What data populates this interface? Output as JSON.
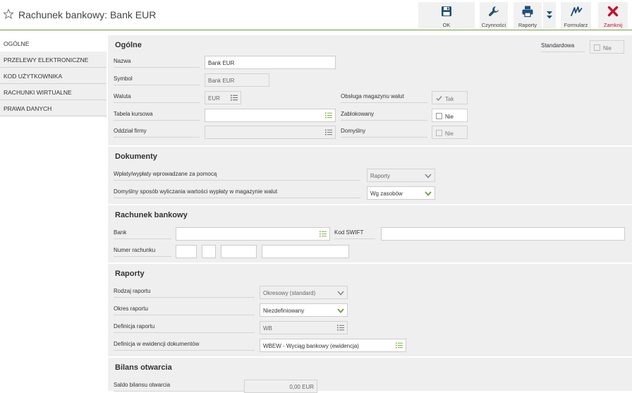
{
  "window": {
    "title": "Rachunek bankowy: Bank EUR"
  },
  "toolbar": {
    "ok": "OK",
    "actions": "Czynności",
    "reports": "Raporty",
    "form": "Formularz",
    "close": "Zamknij"
  },
  "tabs": [
    "OGÓLNE",
    "PRZELEWY ELEKTRONICZNE",
    "KOD UŻYTKOWNIKA",
    "RACHUNKI WIRTUALNE",
    "PRAWA DANYCH"
  ],
  "general": {
    "heading": "Ogólne",
    "standard_label": "Standardowa",
    "standard_value": "Nie",
    "name_label": "Nazwa",
    "name_value": "Bank EUR",
    "symbol_label": "Symbol",
    "symbol_value": "Bank EUR",
    "currency_label": "Waluta",
    "currency_value": "EUR",
    "rate_table_label": "Tabela kursowa",
    "rate_table_value": "",
    "branch_label": "Oddział firmy",
    "branch_value": "",
    "warehouse_label": "Obsługa magazynu walut",
    "warehouse_value": "Tak",
    "blocked_label": "Zablokowany",
    "blocked_value": "Nie",
    "default_label": "Domyślny",
    "default_value": "Nie"
  },
  "documents": {
    "heading": "Dokumenty",
    "entry_label": "Wpłaty/wypłaty wprowadzane za pomocą",
    "entry_value": "Raporty",
    "calc_label": "Domyślny sposób wyliczania wartości wypłaty w magazynie walut",
    "calc_value": "Wg zasobów"
  },
  "bank_account": {
    "heading": "Rachunek bankowy",
    "bank_label": "Bank",
    "bank_value": "",
    "swift_label": "Kod SWIFT",
    "swift_value": "",
    "number_label": "Numer rachunku"
  },
  "reports": {
    "heading": "Raporty",
    "type_label": "Rodzaj raportu",
    "type_value": "Okresowy (standard)",
    "period_label": "Okres raportu",
    "period_value": "Niezdefiniowany",
    "def_label": "Definicja raportu",
    "def_value": "WB",
    "doc_def_label": "Definicja w ewidencji dokumentów",
    "doc_def_value": "WBEW - Wyciąg bankowy (ewidencja)"
  },
  "opening": {
    "heading": "Bilans otwarcia",
    "saldo_label": "Saldo bilansu otwarcia",
    "saldo_value": "0,00 EUR"
  },
  "colors": {
    "accent": "#6d9b38",
    "close": "#c8102e",
    "primary": "#1f4e79"
  }
}
